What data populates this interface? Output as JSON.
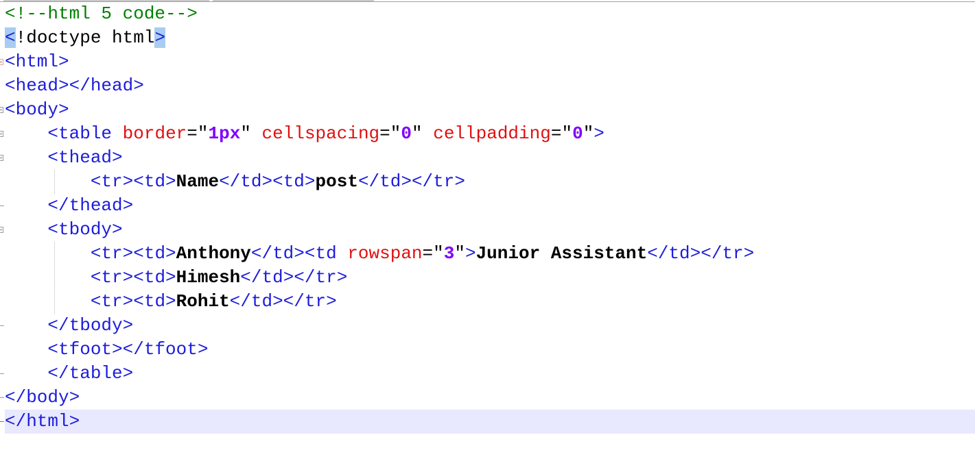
{
  "editor": {
    "colors": {
      "tag": "#1c1cdc",
      "attribute": "#e01010",
      "value": "#8000ff",
      "comment": "#008000",
      "text": "#000000",
      "current_line": "#e8e8ff",
      "selection": "#a8cdf0"
    },
    "tokens": {
      "comment": "<!--html 5 code-->",
      "doctype_open": "<",
      "doctype_bang": "!",
      "doctype_body": "doctype html",
      "doctype_close": ">",
      "html_open": "<html>",
      "head": "<head></head>",
      "body_open": "<body>",
      "table_open": "<table",
      "attr_border": "border",
      "attr_cellspacing": "cellspacing",
      "attr_cellpadding": "cellpadding",
      "attr_rowspan": "rowspan",
      "eq": "=",
      "quote": "\"",
      "val_1px": "1px",
      "val_0": "0",
      "val_3": "3",
      "gt": ">",
      "thead_open": "<thead>",
      "thead_close": "</thead>",
      "tr_td": "<tr><td>",
      "td_close_td_open": "</td><td>",
      "td_close_tr_close": "</td></tr>",
      "td_close": "</td>",
      "td_open_attr": "<td",
      "tbody_open": "<tbody>",
      "tbody_close": "</tbody>",
      "tfoot": "<tfoot></tfoot>",
      "table_close": "</table>",
      "body_close": "</body>",
      "html_close": "</html>",
      "name": "Name",
      "post": "post",
      "anthony": "Anthony",
      "junior_assistant": "Junior Assistant",
      "himesh": "Himesh",
      "rohit": "Rohit"
    }
  }
}
